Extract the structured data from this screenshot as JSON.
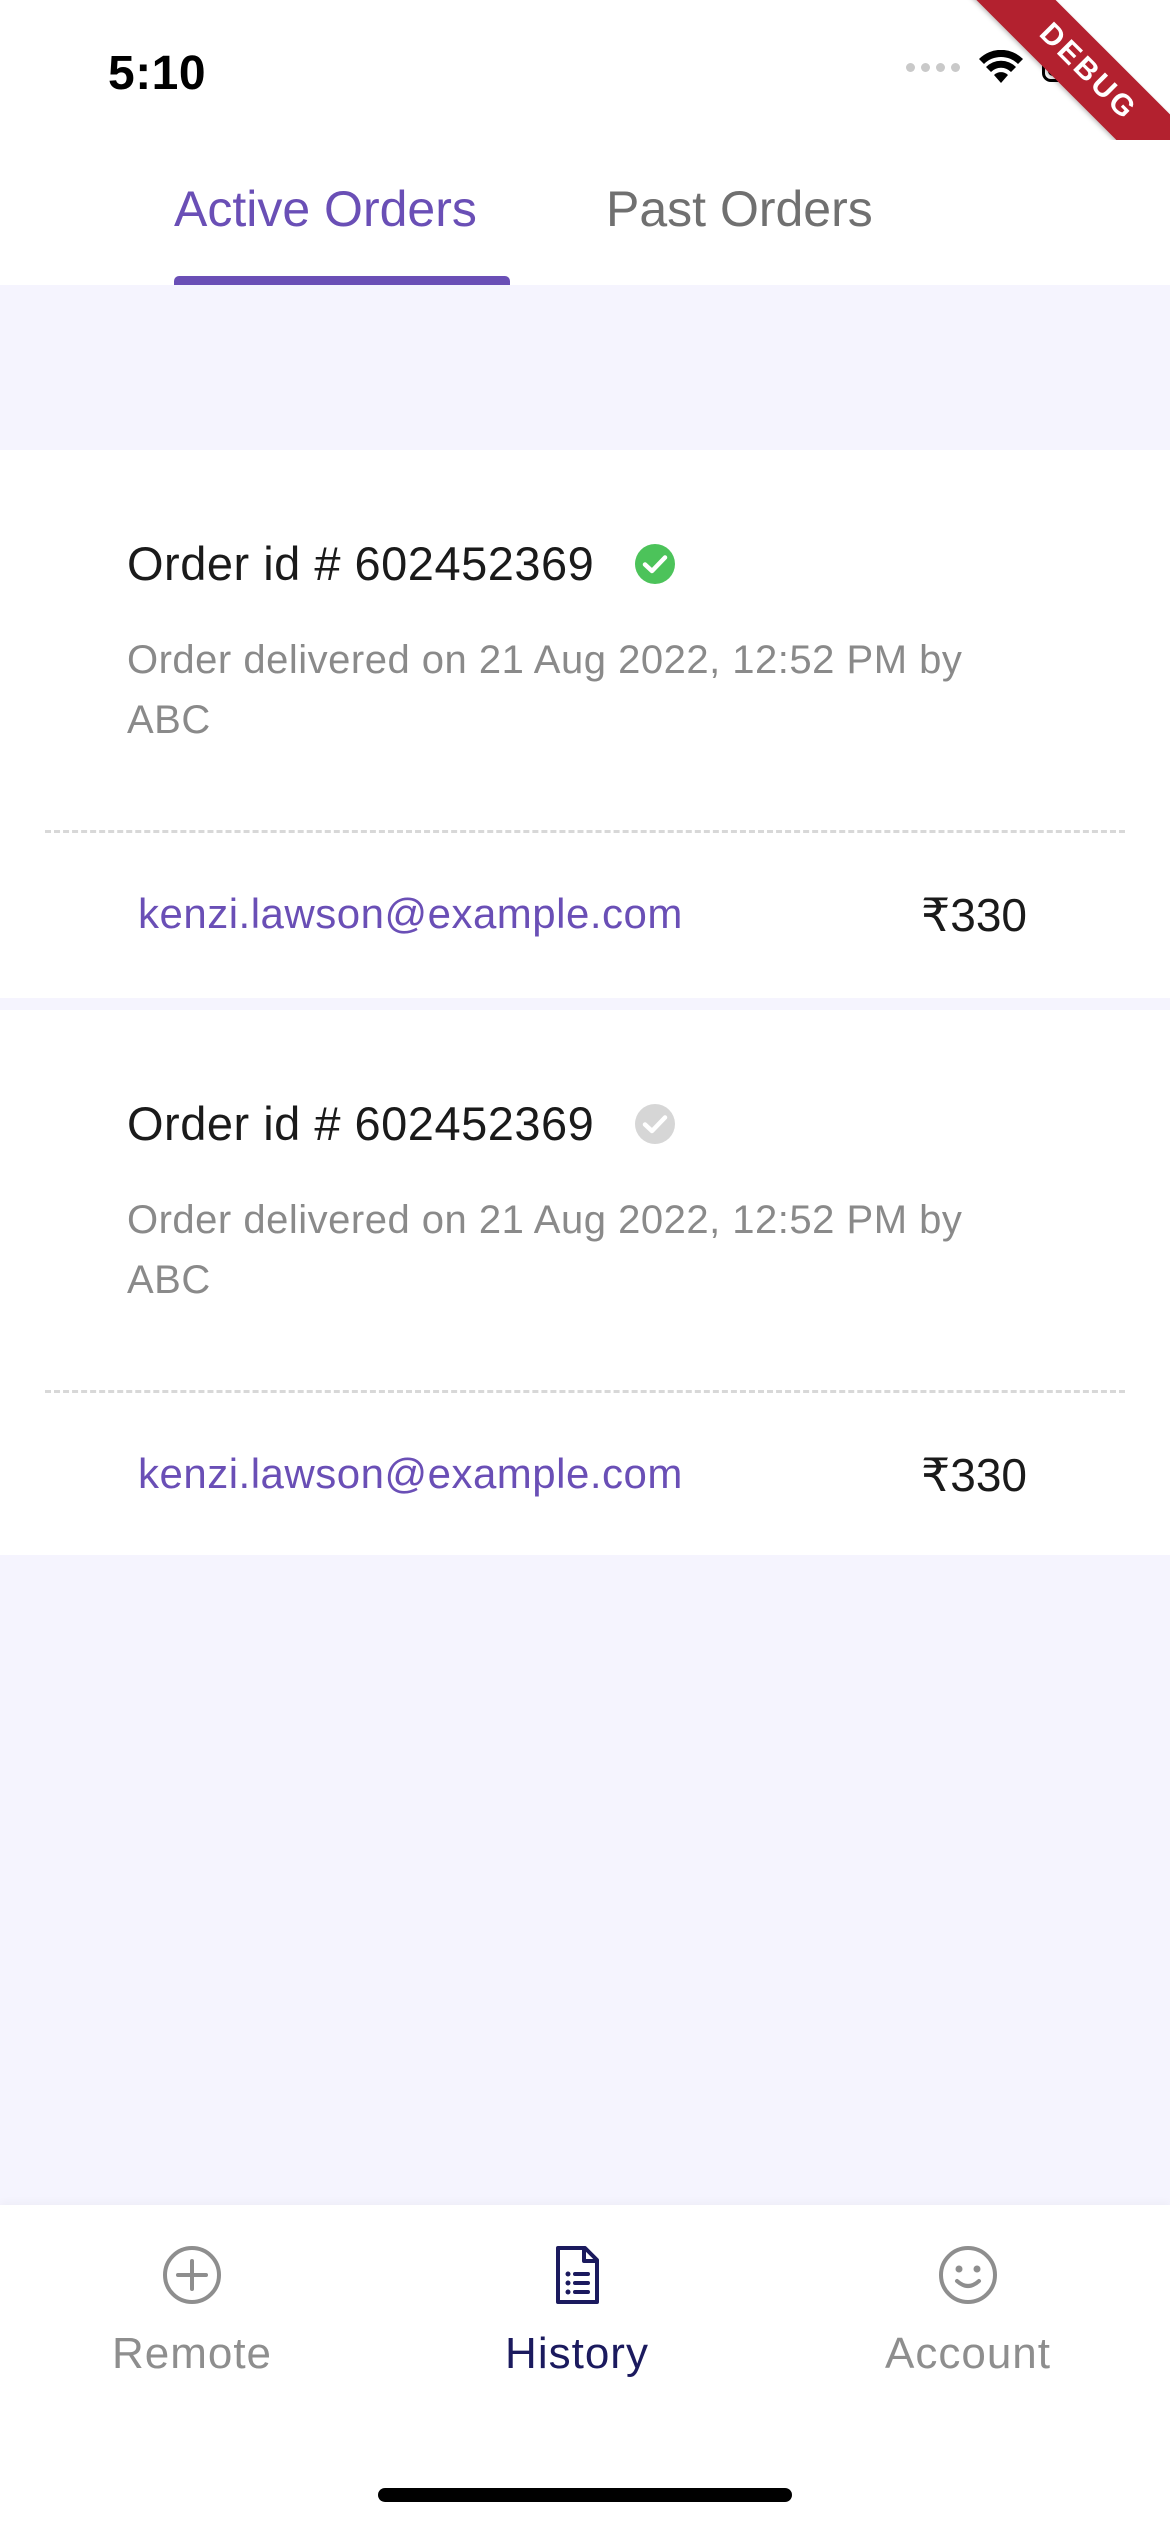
{
  "status_bar": {
    "time": "5:10"
  },
  "debug_banner": "DEBUG",
  "tabs": [
    {
      "label": "Active Orders",
      "active": true
    },
    {
      "label": "Past Orders",
      "active": false
    }
  ],
  "orders": [
    {
      "title": "Order id # 602452369",
      "status_icon": "check-circle-icon",
      "status_color": "#4cc35a",
      "description": "Order delivered on 21 Aug 2022, 12:52 PM by ABC",
      "email": "kenzi.lawson@example.com",
      "price": "₹330"
    },
    {
      "title": "Order id # 602452369",
      "status_icon": "check-circle-icon",
      "status_color": "#d6d6d6",
      "description": "Order delivered on 21 Aug 2022, 12:52 PM by ABC",
      "email": "kenzi.lawson@example.com",
      "price": "₹330"
    }
  ],
  "bottom_nav": {
    "items": [
      {
        "label": "Remote",
        "icon": "plus-circle-icon",
        "active": false
      },
      {
        "label": "History",
        "icon": "document-icon",
        "active": true
      },
      {
        "label": "Account",
        "icon": "smiley-icon",
        "active": false
      }
    ]
  },
  "colors": {
    "accent": "#6a4fb6",
    "background": "#f5f4fe",
    "nav_active": "#1b1a5e",
    "delivered_green": "#4cc35a"
  }
}
